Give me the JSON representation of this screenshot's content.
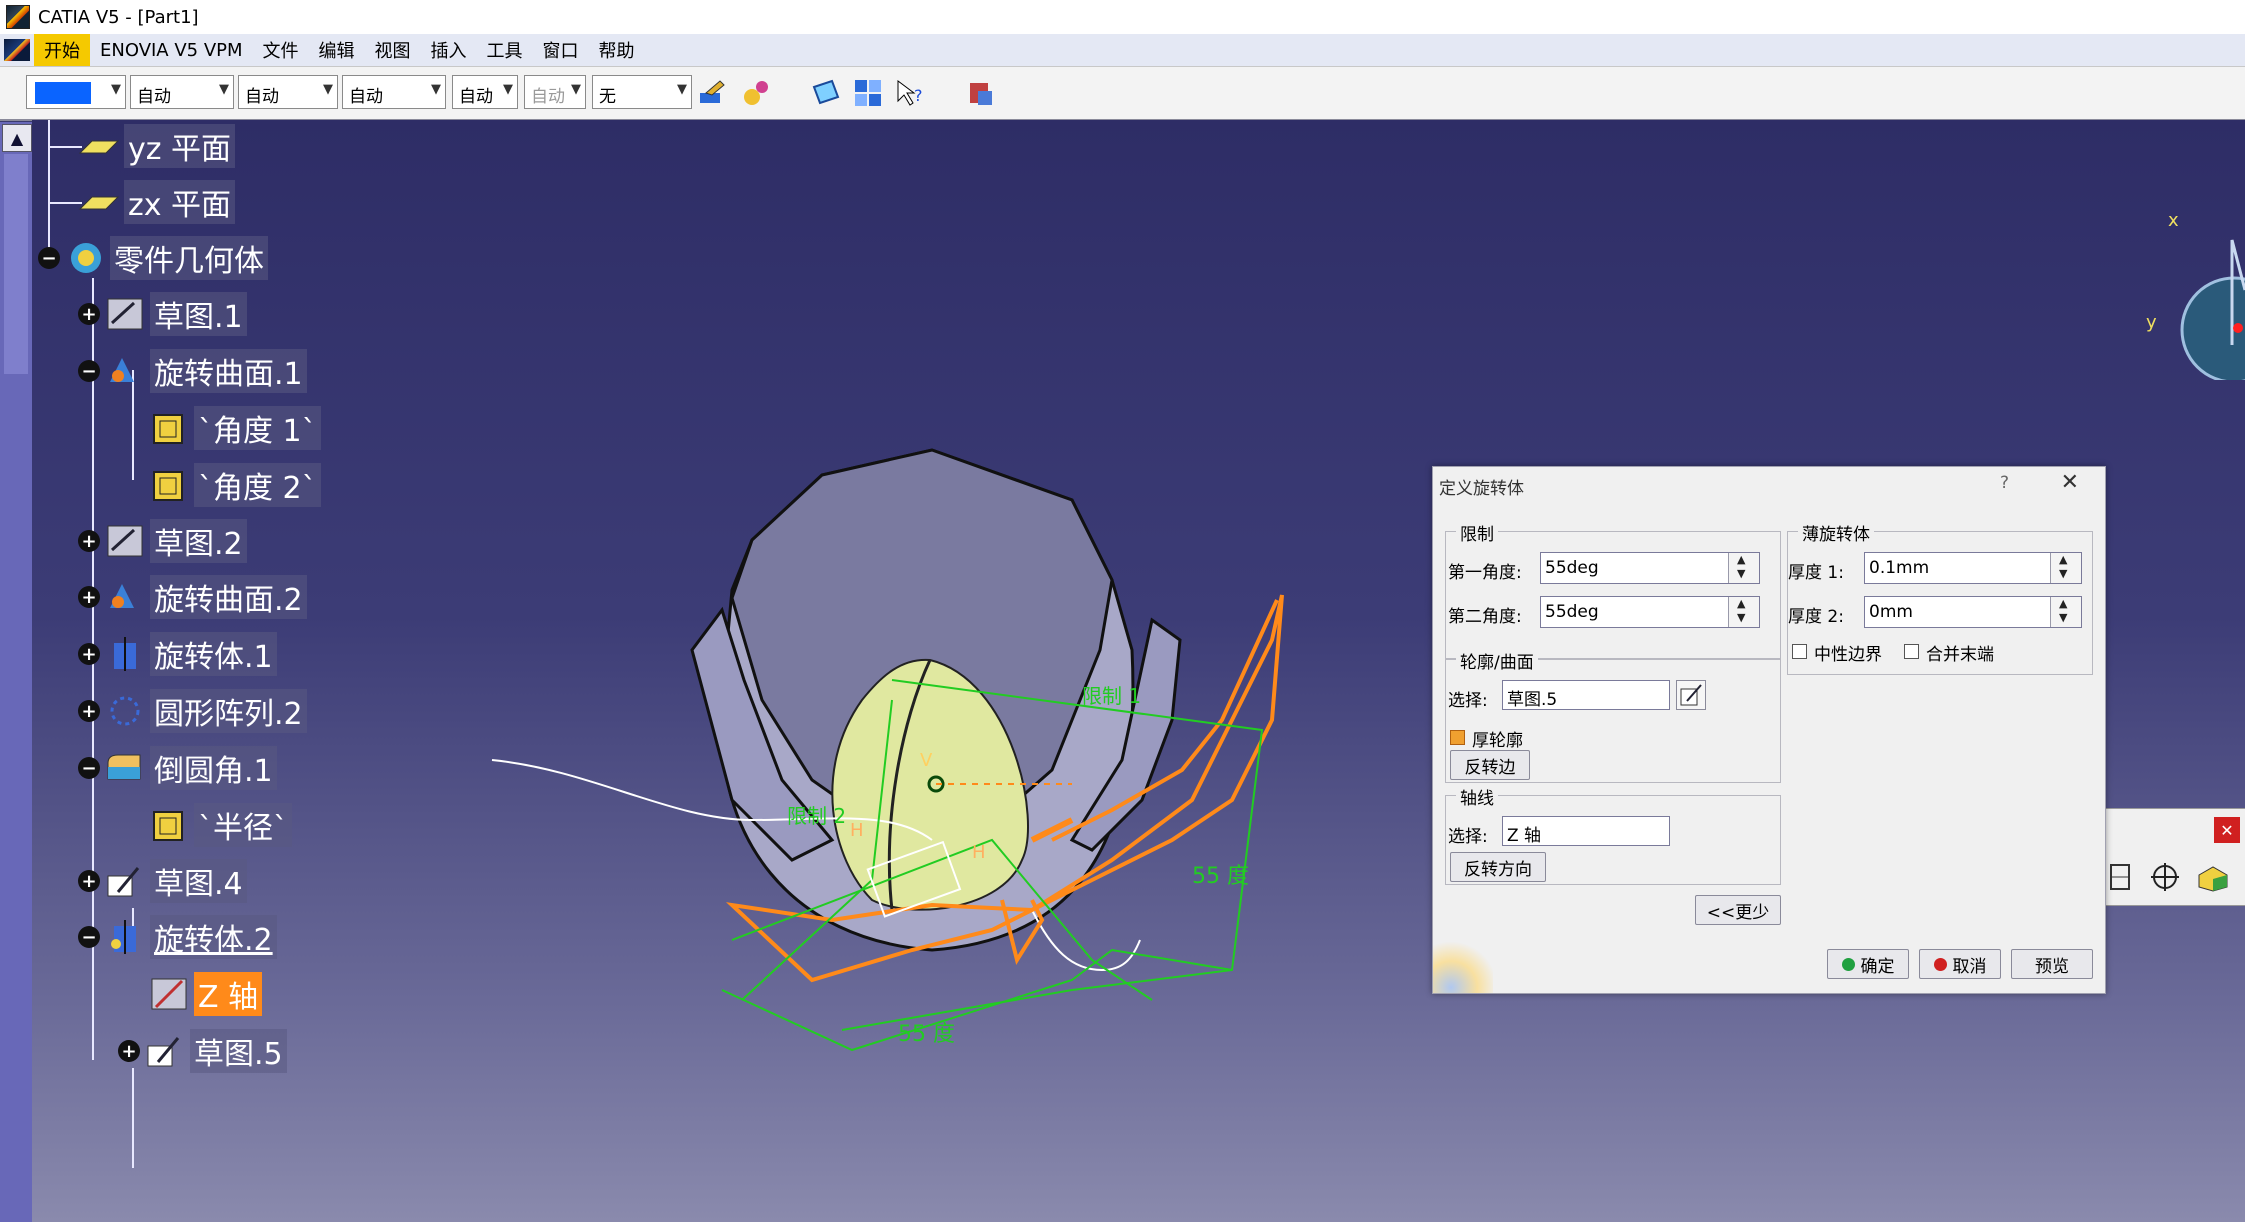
{
  "window": {
    "title": "CATIA V5 - [Part1]"
  },
  "menu": {
    "items": [
      {
        "label": "开始",
        "active": true
      },
      {
        "label": "ENOVIA V5 VPM"
      },
      {
        "label": "文件"
      },
      {
        "label": "编辑"
      },
      {
        "label": "视图"
      },
      {
        "label": "插入"
      },
      {
        "label": "工具"
      },
      {
        "label": "窗口"
      },
      {
        "label": "帮助"
      }
    ]
  },
  "toolbar": {
    "color_swatch": "#0a64ff",
    "combos": [
      "自动",
      "自动",
      "自动",
      "自动",
      "自动",
      "无"
    ],
    "icons": [
      "brush-icon",
      "paint-bucket-icon",
      "plane-select-icon",
      "multi-view-icon",
      "help-pointer-icon",
      "user-tools-icon"
    ]
  },
  "tree": {
    "nodes": [
      {
        "label": "yz 平面",
        "icon": "plane-icon"
      },
      {
        "label": "zx 平面",
        "icon": "plane-icon"
      },
      {
        "label": "零件几何体",
        "icon": "part-body-icon",
        "toggle": "−"
      },
      {
        "label": "草图.1",
        "icon": "sketch-icon",
        "toggle": "+"
      },
      {
        "label": "旋转曲面.1",
        "icon": "revolve-surface-icon",
        "toggle": "−"
      },
      {
        "label": "`角度 1`",
        "icon": "parameter-icon"
      },
      {
        "label": "`角度 2`",
        "icon": "parameter-icon"
      },
      {
        "label": "草图.2",
        "icon": "sketch-icon",
        "toggle": "+"
      },
      {
        "label": "旋转曲面.2",
        "icon": "revolve-surface-icon",
        "toggle": "+"
      },
      {
        "label": "旋转体.1",
        "icon": "shaft-icon",
        "toggle": "+"
      },
      {
        "label": "圆形阵列.2",
        "icon": "circular-pattern-icon",
        "toggle": "+"
      },
      {
        "label": "倒圆角.1",
        "icon": "fillet-icon",
        "toggle": "−"
      },
      {
        "label": "`半径`",
        "icon": "parameter-icon"
      },
      {
        "label": "草图.4",
        "icon": "sketch-icon",
        "toggle": "+"
      },
      {
        "label": "旋转体.2",
        "icon": "shaft-icon",
        "toggle": "−",
        "underline": true
      },
      {
        "label": "Z 轴",
        "icon": "axis-icon",
        "selected": true
      },
      {
        "label": "草图.5",
        "icon": "sketch-icon",
        "toggle": "+"
      }
    ]
  },
  "viewport": {
    "labels": {
      "limit1": "限制 1",
      "limit2": "限制 2",
      "angle_a": "55 度",
      "angle_b": "55 度",
      "h1": "H",
      "h2": "H",
      "v": "V"
    },
    "compass": {
      "x": "x",
      "y": "y"
    },
    "colors": {
      "accent": "#ff8a1a",
      "guide": "#22cc22"
    }
  },
  "dialog": {
    "title": "定义旋转体",
    "help": "?",
    "limits": {
      "group": "限制",
      "first_label": "第一角度:",
      "first_value": "55deg",
      "second_label": "第二角度:",
      "second_value": "55deg"
    },
    "thin": {
      "group": "薄旋转体",
      "t1_label": "厚度 1:",
      "t1_value": "0.1mm",
      "t2_label": "厚度 2:",
      "t2_value": "0mm",
      "neutral": "中性边界",
      "merge": "合并末端"
    },
    "profile": {
      "group": "轮廓/曲面",
      "select_label": "选择:",
      "select_value": "草图.5",
      "thick": "厚轮廓",
      "reverse": "反转边"
    },
    "axis": {
      "group": "轴线",
      "select_label": "选择:",
      "select_value": "Z 轴",
      "reverse": "反转方向"
    },
    "less": "<<更少",
    "ok": "确定",
    "cancel": "取消",
    "preview": "预览"
  }
}
